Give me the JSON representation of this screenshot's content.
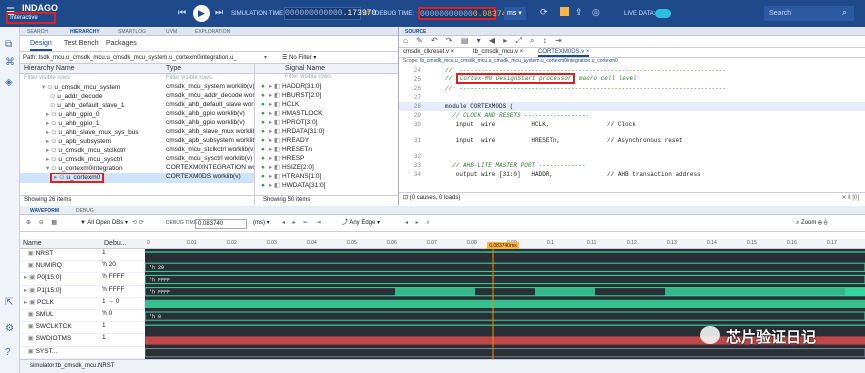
{
  "app": {
    "brand": "INDAGO",
    "mode": "Interactive"
  },
  "toolbar": {
    "sim_time_label": "SIMULATION TIME:",
    "sim_time_value": "000000000000.173970",
    "sim_time_prefix": "000000000000",
    "sim_time_main": ".173970",
    "debug_time_label": "DEBUG TIME:",
    "debug_time_prefix": "00000000000",
    "debug_time_main": "0.083740",
    "unit": "ms",
    "live_data_label": "LIVE DATA:",
    "search_placeholder": "Search"
  },
  "top_tabs": [
    "SEARCH",
    "HIERARCHY",
    "SMARTLOG",
    "UVM",
    "EXPLORATION"
  ],
  "sub_tabs": [
    "Design",
    "Test Bench",
    "Packages"
  ],
  "path": {
    "label": "Path:",
    "value": "tsdk_mcu.u_cmsdk_mcu.u_cmsdk_mcu_system.u_cortexm0integration.u_",
    "filter": "No Filter"
  },
  "hierarchy": {
    "col_name": "Hierarchy Name",
    "col_type": "Type",
    "filter_placeholder": "Filter visible rows",
    "rows": [
      {
        "name": "u_cmsdk_mcu_system",
        "type": "cmsdk_mcu_system worklib(v)"
      },
      {
        "name": "u_addr_decode",
        "type": "cmsdk_mcu_addr_decode worklib"
      },
      {
        "name": "u_ahb_default_slave_1",
        "type": "cmsdk_ahb_default_slave worklib"
      },
      {
        "name": "u_ahb_gpio_0",
        "type": "cmsdk_ahb_gpio worklib(v)"
      },
      {
        "name": "u_ahb_gpio_1",
        "type": "cmsdk_ahb_gpio worklib(v)"
      },
      {
        "name": "u_ahb_slave_mux_sys_bus",
        "type": "cmsdk_ahb_slave_mux worklib(v)"
      },
      {
        "name": "u_apb_subsystem",
        "type": "cmsdk_apb_subsystem worklib(v)"
      },
      {
        "name": "u_cmsdk_mcu_stclkctrl",
        "type": "cmsdk_mcu_stclkctrl worklib(v)"
      },
      {
        "name": "u_cmsdk_mcu_sysctrl",
        "type": "cmsdk_mcu_sysctrl worklib(v)"
      },
      {
        "name": "u_cortexm0integration",
        "type": "CORTEXM0INTEGRATION worklib"
      },
      {
        "name": "u_cortexm0",
        "type": "CORTEXM0DS worklib(v)"
      }
    ],
    "status": "Showing 26 items"
  },
  "signals": {
    "col_name": "Signal Name",
    "filter_placeholder": "Filter visible rows",
    "rows": [
      "HADDR[31:0]",
      "HBURST[2:0]",
      "HCLK",
      "HMASTLOCK",
      "HPROT[3:0]",
      "HRDATA[31:0]",
      "HREADY",
      "HRESETn",
      "HRESP",
      "HSIZE[2:0]",
      "HTRANS[1:0]",
      "HWDATA[31:0]"
    ],
    "status": "Showing 50 items"
  },
  "source": {
    "tab": "SOURCE",
    "files": [
      "cmsdk_clkreset.v",
      "tb_cmsdk_mcu.v",
      "CORTEXM0DS.v"
    ],
    "scope_label": "Scope:",
    "scope": "tb_cmsdk_mcu.u_cmsdk_mcu.u_cmsdk_mcu_system.u_cortexm0integration.u_cortexm0",
    "lines": [
      {
        "n": "24",
        "t": "//  --------------------------------------------------------------------------"
      },
      {
        "n": "25",
        "t": "Cortex-M0 DesignStart processor",
        "rest": "macro cell level"
      },
      {
        "n": "26",
        "t": "//  --------------------------------------------------------------------------"
      },
      {
        "n": "27",
        "t": ""
      },
      {
        "n": "28",
        "t": "module CORTEXM0DS ("
      },
      {
        "n": "29",
        "t": "  // CLOCK AND RESETS ------------------"
      },
      {
        "n": "30",
        "t": "   input  wire          HCLK,                // Clock"
      },
      {
        "n": "31",
        "t": "   input  wire          HRESETn,             // Asynchronous reset"
      },
      {
        "n": "32",
        "t": ""
      },
      {
        "n": "33",
        "t": "  // AHB-LITE MASTER PORT -------------"
      },
      {
        "n": "34",
        "t": "   output wire [31:0]   HADDR,               // AHB transaction address"
      }
    ],
    "status": "(0 causes, 0 loads)"
  },
  "wave": {
    "tabs": [
      "WAVEFORM",
      "DEBUG"
    ],
    "toolbar": {
      "filter": "All Open DBs",
      "debug_time_label": "DEBUG TIME",
      "debug_time": "0.083740",
      "unit": "(ms)",
      "edge": "Any Edge",
      "zoom": "Zoom"
    },
    "col_name": "Name",
    "col_debug": "Debu...",
    "cursor_label": "0.083740ms",
    "ticks": [
      "0",
      "0.01",
      "0.02",
      "0.03",
      "0.04",
      "0.05",
      "0.06",
      "0.07",
      "0.08",
      "0.09",
      "0.1",
      "0.11",
      "0.12",
      "0.13",
      "0.14",
      "0.15",
      "0.16",
      "0.17"
    ],
    "rows": [
      {
        "name": "NRST",
        "val": "1"
      },
      {
        "name": "NUMIRQ",
        "val": "'h 20"
      },
      {
        "name": "P0[15:0]",
        "val": "'h FFFF"
      },
      {
        "name": "P1[15:0]",
        "val": "'h FFFF"
      },
      {
        "name": "PCLK",
        "val": "1 → 0"
      },
      {
        "name": "SMUL",
        "val": "'h 0"
      },
      {
        "name": "SWCLKTCK",
        "val": "1"
      },
      {
        "name": "SWDIOTMS",
        "val": "1"
      },
      {
        "name": "SYST...",
        "val": ""
      }
    ],
    "status": "simulator:tb_cmsdk_mcu.NRST"
  },
  "watermark": "芯片验证日记",
  "colors": {
    "header": "#1e4a8c",
    "wave_green": "#38d9a0",
    "highlight_red": "#e02020",
    "cursor": "#ff8a00"
  }
}
